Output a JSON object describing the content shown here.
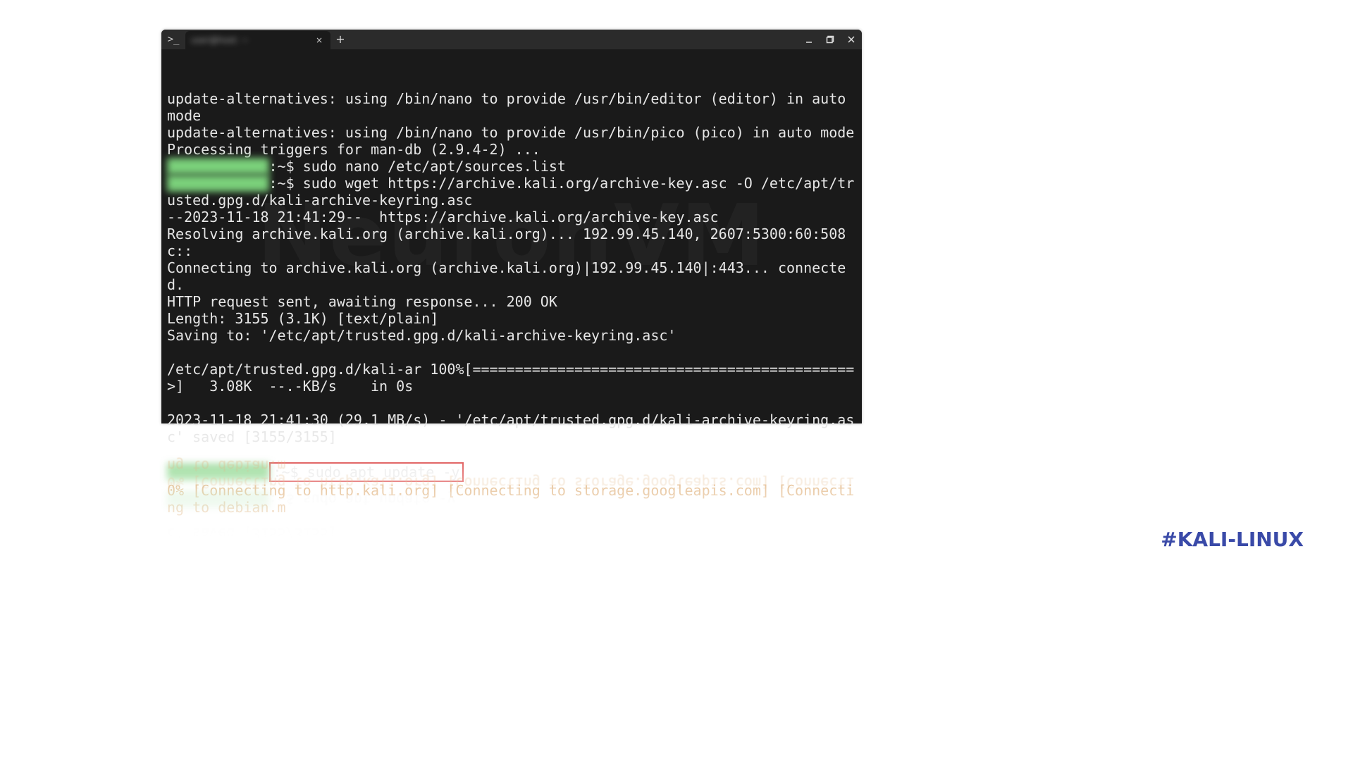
{
  "titlebar": {
    "app_icon": ">_",
    "tab_title": "user@host: ~",
    "close_glyph": "×",
    "newtab_glyph": "+"
  },
  "lines": {
    "l1": "update-alternatives: using /bin/nano to provide /usr/bin/editor (editor) in auto mode",
    "l2": "update-alternatives: using /bin/nano to provide /usr/bin/pico (pico) in auto mode",
    "l3": "Processing triggers for man-db (2.9.4-2) ...",
    "p1_host": "████████████",
    "p1_rest": ":~$ sudo nano /etc/apt/sources.list",
    "p2_host": "████████████",
    "p2_rest": ":~$ sudo wget https://archive.kali.org/archive-key.asc -O /etc/apt/trusted.gpg.d/kali-archive-keyring.asc",
    "l4": "--2023-11-18 21:41:29--  https://archive.kali.org/archive-key.asc",
    "l5": "Resolving archive.kali.org (archive.kali.org)... 192.99.45.140, 2607:5300:60:508c::",
    "l6": "Connecting to archive.kali.org (archive.kali.org)|192.99.45.140|:443... connected.",
    "l7": "HTTP request sent, awaiting response... 200 OK",
    "l8": "Length: 3155 (3.1K) [text/plain]",
    "l9": "Saving to: '/etc/apt/trusted.gpg.d/kali-archive-keyring.asc'",
    "blank1": "",
    "l10": "/etc/apt/trusted.gpg.d/kali-ar 100%[=============================================>]   3.08K  --.-KB/s    in 0s",
    "blank2": "",
    "l11": "2023-11-18 21:41:30 (29.1 MB/s) - '/etc/apt/trusted.gpg.d/kali-archive-keyring.asc' saved [3155/3155]",
    "blank3": "",
    "p3_host": "████████████",
    "p3_rest": ":~$ sudo apt update -y",
    "status": "0% [Connecting to http.kali.org] [Connecting to storage.googleapis.com] [Connecting to debian.m"
  },
  "watermark": "NeuronVM",
  "hashtag": "#KALI-LINUX"
}
